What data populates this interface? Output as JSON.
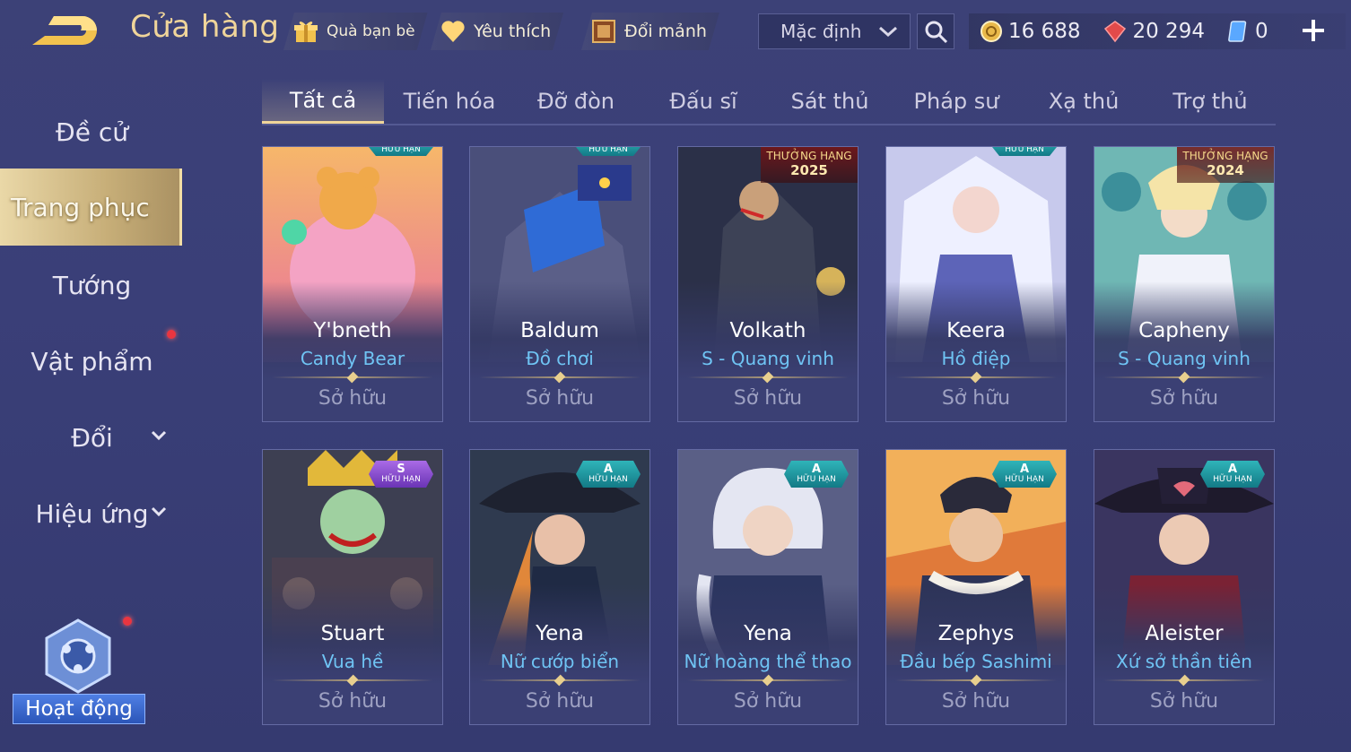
{
  "header": {
    "title": "Cửa hàng",
    "gift_label": "Quà bạn bè",
    "favorite_label": "Yêu thích",
    "exchange_label": "Đổi mảnh",
    "sort_value": "Mặc định"
  },
  "currency": {
    "gold": "16 688",
    "vouchers": "20 294",
    "quan_huy": "0"
  },
  "sidebar": {
    "items": [
      {
        "label": "Đề cử"
      },
      {
        "label": "Trang phục"
      },
      {
        "label": "Tướng"
      },
      {
        "label": "Vật phẩm"
      },
      {
        "label": "Đổi"
      },
      {
        "label": "Hiệu ứng"
      }
    ],
    "activity_label": "Hoạt động"
  },
  "tabs": [
    {
      "label": "Tất cả"
    },
    {
      "label": "Tiến hóa"
    },
    {
      "label": "Đỡ đòn"
    },
    {
      "label": "Đấu sĩ"
    },
    {
      "label": "Sát thủ"
    },
    {
      "label": "Pháp sư"
    },
    {
      "label": "Xạ thủ"
    },
    {
      "label": "Trợ thủ"
    }
  ],
  "cards": [
    {
      "hero": "Y'bneth",
      "skin": "Candy Bear",
      "status": "Sở hữu",
      "badge": "HỮU HẠN"
    },
    {
      "hero": "Baldum",
      "skin": "Đồ chơi",
      "status": "Sở hữu",
      "badge": "HỮU HẠN"
    },
    {
      "hero": "Volkath",
      "skin": "S - Quang vinh",
      "status": "Sở hữu",
      "badge": "THƯỞNG HẠNG",
      "badge_year": "2025"
    },
    {
      "hero": "Keera",
      "skin": "Hồ điệp",
      "status": "Sở hữu",
      "badge": "HỮU HẠN"
    },
    {
      "hero": "Capheny",
      "skin": "S - Quang vinh",
      "status": "Sở hữu",
      "badge": "THƯỞNG HẠNG",
      "badge_year": "2024"
    },
    {
      "hero": "Stuart",
      "skin": "Vua hề",
      "status": "Sở hữu",
      "badge": "HỮU HẠN",
      "tier": "S"
    },
    {
      "hero": "Yena",
      "skin": "Nữ cướp biển",
      "status": "Sở hữu",
      "badge": "HỮU HẠN",
      "tier": "A"
    },
    {
      "hero": "Yena",
      "skin": "Nữ hoàng thể thao",
      "status": "Sở hữu",
      "badge": "HỮU HẠN",
      "tier": "A"
    },
    {
      "hero": "Zephys",
      "skin": "Đầu bếp Sashimi",
      "status": "Sở hữu",
      "badge": "HỮU HẠN",
      "tier": "A"
    },
    {
      "hero": "Aleister",
      "skin": "Xứ sở thần tiên",
      "status": "Sở hữu",
      "badge": "HỮU HẠN",
      "tier": "A"
    }
  ],
  "colors": {
    "background": "#3a3f78",
    "title_gold": "#f0d59a",
    "skin_name_blue": "#6fc4f4",
    "active_gold": "#e0c98e",
    "notification_red": "#ea3540"
  },
  "icons": [
    "back-arrow-icon",
    "gift-icon",
    "heart-icon",
    "book-icon",
    "chevron-down-icon",
    "search-icon",
    "gold-coin-icon",
    "ruby-icon",
    "crystal-card-icon",
    "plus-icon"
  ]
}
